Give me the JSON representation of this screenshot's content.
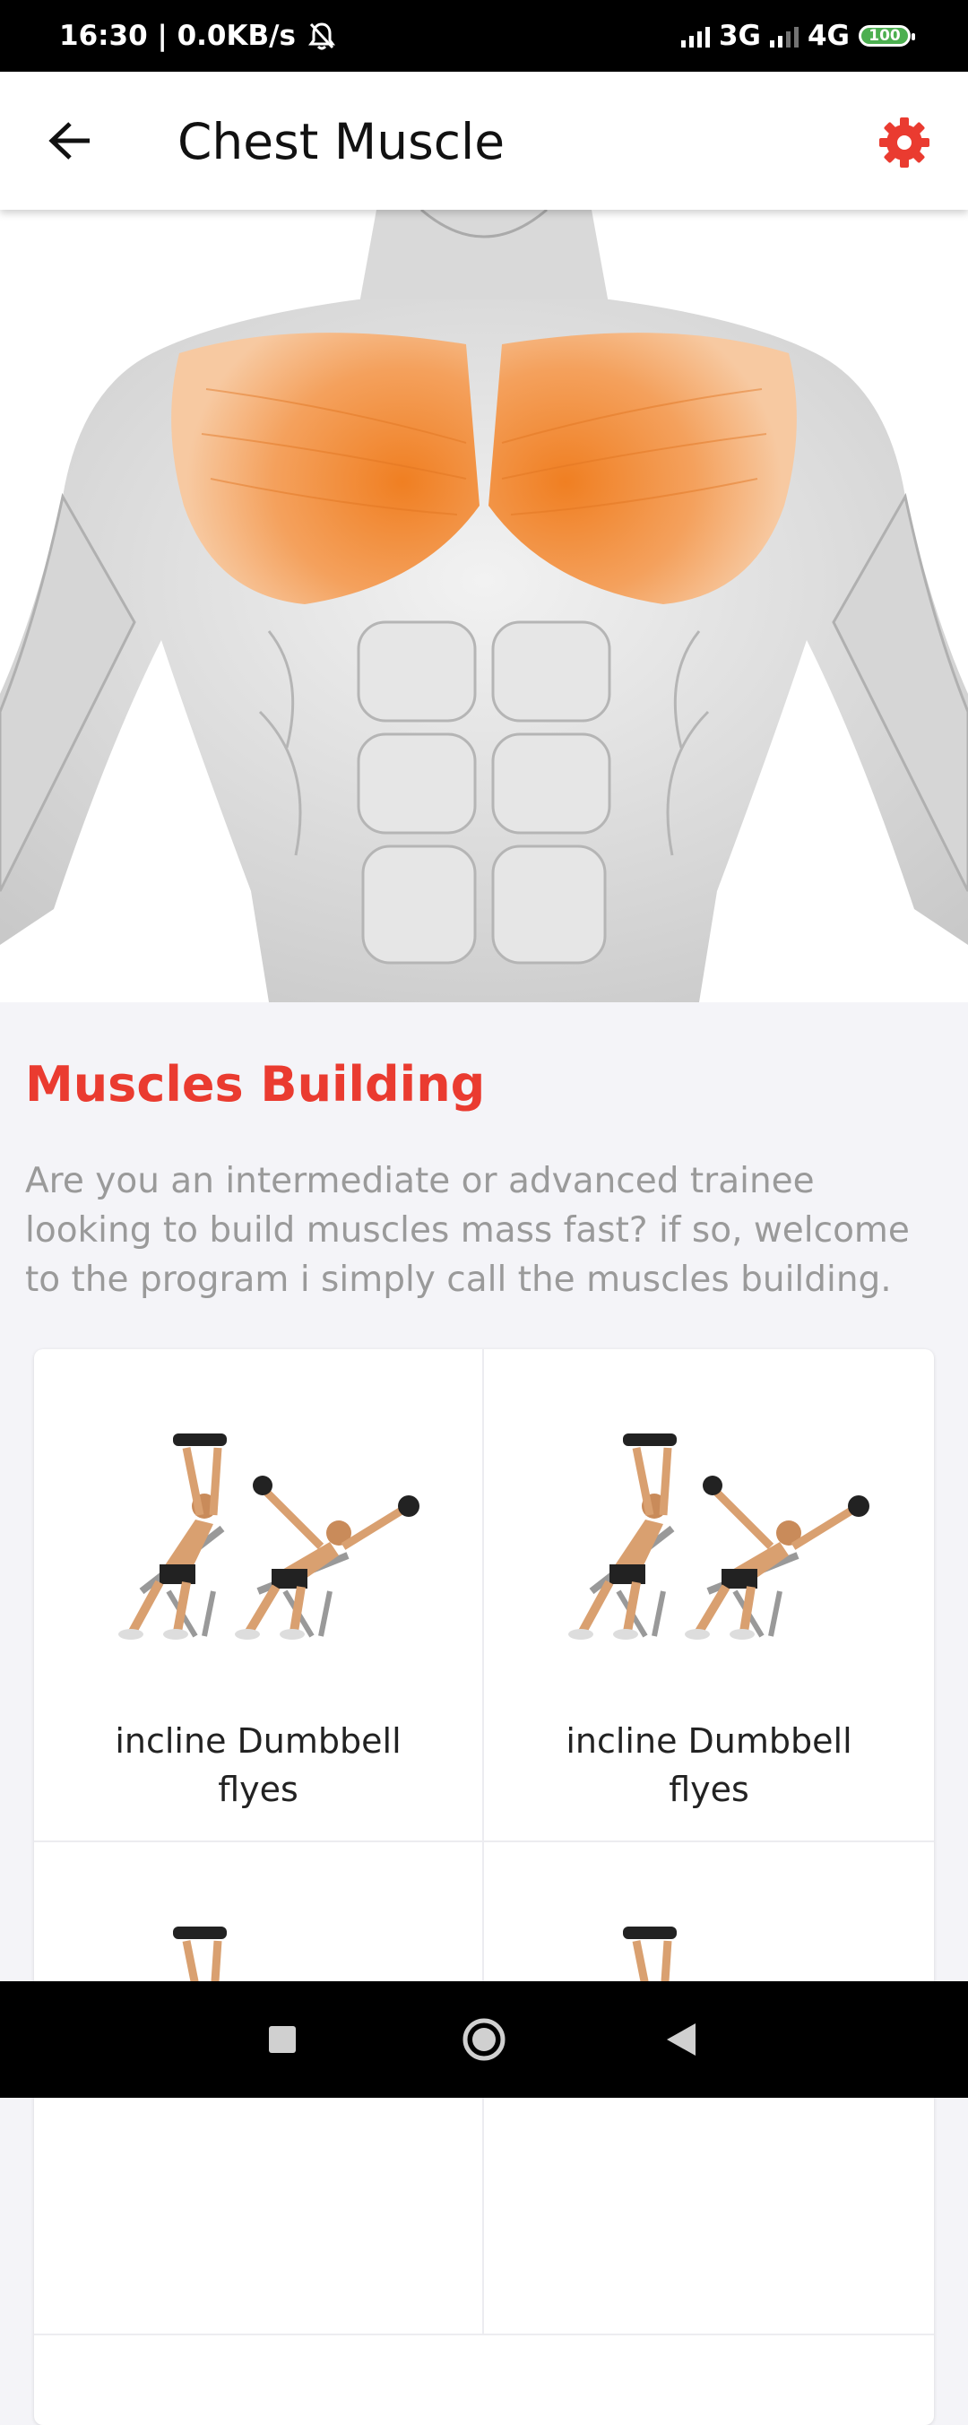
{
  "status_bar": {
    "time_speed": "16:30 | 0.0KB/s",
    "network_1": "3G",
    "network_2": "4G",
    "battery": "100"
  },
  "app_bar": {
    "title": "Chest Muscle"
  },
  "intro": {
    "title": "Muscles Building",
    "description": "Are you an intermediate or advanced trainee looking to build muscles mass fast? if so, welcome to the program i simply call the muscles building."
  },
  "exercises": [
    {
      "label": "incline Dumbbell flyes"
    },
    {
      "label": "incline Dumbbell flyes"
    },
    {
      "label": ""
    },
    {
      "label": ""
    }
  ],
  "colors": {
    "accent": "#ea3b30",
    "highlight_muscle": "#f28a2e",
    "background": "#f4f4f8"
  },
  "icons": {
    "back": "arrow-left-icon",
    "settings": "gear-icon",
    "mute": "bell-off-icon",
    "nav_recent": "square-icon",
    "nav_home": "circle-icon",
    "nav_back": "triangle-icon"
  }
}
